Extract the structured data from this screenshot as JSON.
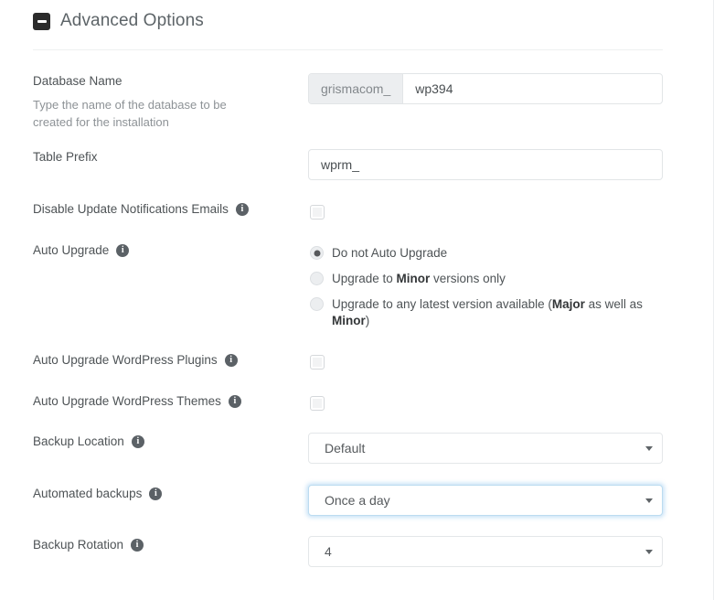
{
  "panel": {
    "title": "Advanced Options",
    "collapse_icon": "minus-square-icon",
    "collapsed": false
  },
  "info_icon_glyph": "i",
  "fields": {
    "database_name": {
      "label": "Database Name",
      "help": "Type the name of the database to be created for the installation",
      "prefix": "grismacom_",
      "value": "wp394",
      "placeholder": ""
    },
    "table_prefix": {
      "label": "Table Prefix",
      "value": "wprm_",
      "placeholder": ""
    },
    "disable_update_emails": {
      "label": "Disable Update Notifications Emails",
      "checked": false
    },
    "auto_upgrade": {
      "label": "Auto Upgrade",
      "selected_index": 0,
      "options": [
        {
          "text_before": "Do not Auto Upgrade",
          "bold": "",
          "text_after": ""
        },
        {
          "text_before": "Upgrade to ",
          "bold": "Minor",
          "text_after": " versions only"
        },
        {
          "text_before": "Upgrade to any latest version available (",
          "bold": "Major",
          "text_after": " as well as "
        },
        {
          "text_before": "",
          "bold": "Minor",
          "text_after": ")"
        }
      ],
      "option_1_full": "Do not Auto Upgrade",
      "option_2_full": "Upgrade to Minor versions only",
      "option_3_full": "Upgrade to any latest version available (Major as well as Minor)"
    },
    "auto_upgrade_plugins": {
      "label": "Auto Upgrade WordPress Plugins",
      "checked": false
    },
    "auto_upgrade_themes": {
      "label": "Auto Upgrade WordPress Themes",
      "checked": false
    },
    "backup_location": {
      "label": "Backup Location",
      "value": "Default",
      "focused": false
    },
    "automated_backups": {
      "label": "Automated backups",
      "value": "Once a day",
      "focused": true
    },
    "backup_rotation": {
      "label": "Backup Rotation",
      "value": "4",
      "focused": false
    }
  },
  "colors": {
    "label_text": "#4e5356",
    "help_text": "#8d9296",
    "title_text": "#5d6468",
    "border": "#e2e5e7",
    "addon_bg": "#eceef0",
    "focus_glow": "#66afe9",
    "icon_dark": "#5b6166"
  }
}
